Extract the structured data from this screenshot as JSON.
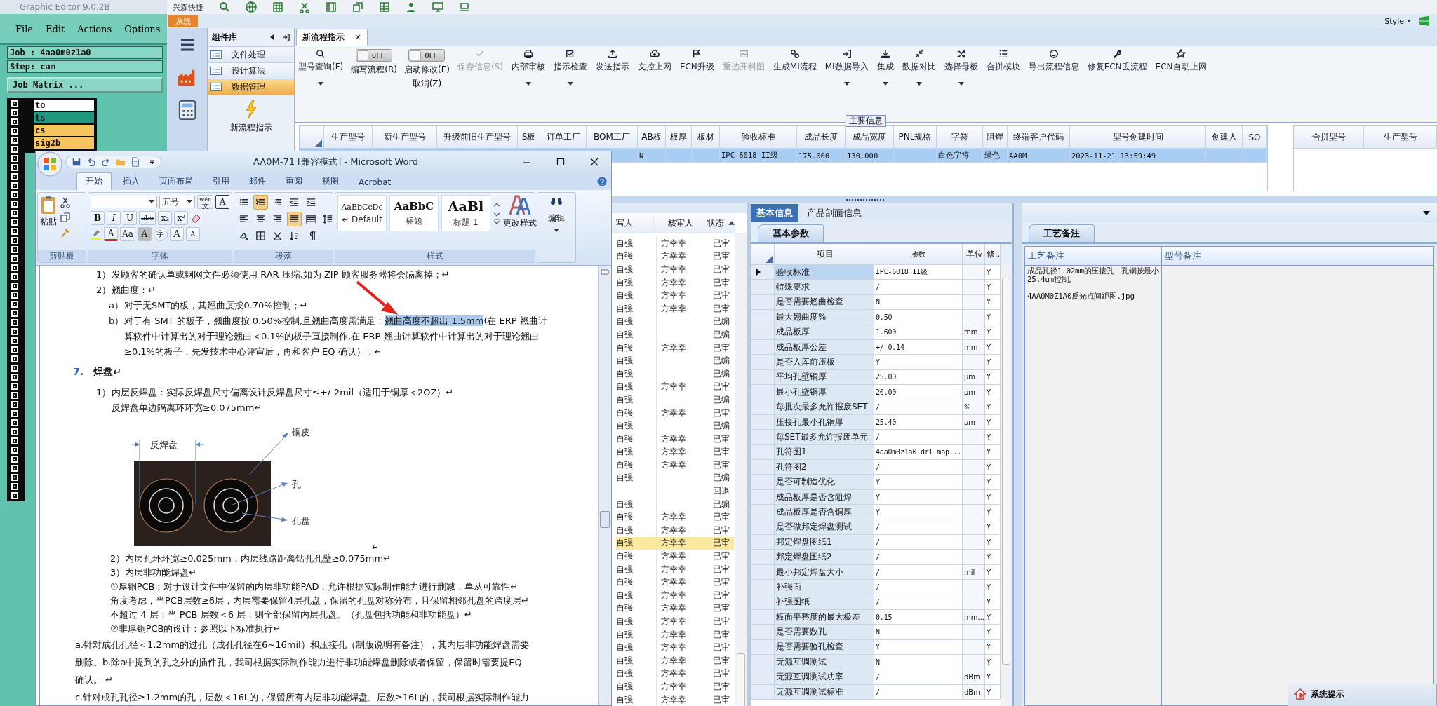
{
  "editor": {
    "title": "Graphic Editor 9.0.2B",
    "menu": [
      "File",
      "Edit",
      "Actions",
      "Options"
    ],
    "job": "Job : 4aa0m0z1a0",
    "step": "Step: cam",
    "matrix_button": "Job Matrix ...",
    "layers": [
      {
        "name": "to",
        "color": "#ffffff"
      },
      {
        "name": "ts",
        "color": "#1f9a80"
      },
      {
        "name": "cs",
        "color": "#f7c45e"
      },
      {
        "name": "sig2b",
        "color": "#f7c45e"
      }
    ]
  },
  "app": {
    "quick_label": "兴森快捷",
    "system_tab": "系统",
    "style_menu": "Style",
    "component_library": {
      "title": "组件库",
      "items": [
        {
          "label": "文件处理",
          "selected": false
        },
        {
          "label": "设计算法",
          "selected": false
        },
        {
          "label": "数据管理",
          "selected": true
        }
      ],
      "launcher": "新流程指示"
    },
    "tab": {
      "label": "新流程指示",
      "close": "×"
    },
    "toolbar": [
      {
        "kind": "button",
        "label": "型号查询(F)",
        "dropdown": true,
        "disabled": false
      },
      {
        "kind": "toggle",
        "text": "OFF",
        "on": false,
        "labels": [
          "编写流程(R)"
        ]
      },
      {
        "kind": "toggle",
        "text": "OFF",
        "on": false,
        "labels": [
          "启动修改(E)",
          "取消(Z)"
        ]
      },
      {
        "kind": "button",
        "label": "保存信息(S)",
        "dropdown": false,
        "disabled": true
      },
      {
        "kind": "button",
        "label": "内部审核",
        "dropdown": true,
        "disabled": false
      },
      {
        "kind": "button",
        "label": "指示检查",
        "dropdown": true,
        "disabled": false
      },
      {
        "kind": "button",
        "label": "发送指示",
        "dropdown": false,
        "disabled": false
      },
      {
        "kind": "button",
        "label": "文控上网",
        "dropdown": false,
        "disabled": false
      },
      {
        "kind": "button",
        "label": "ECN升级",
        "dropdown": false,
        "disabled": false
      },
      {
        "kind": "button",
        "label": "重选开料图",
        "dropdown": false,
        "disabled": true
      },
      {
        "kind": "button",
        "label": "生成MI流程",
        "dropdown": false,
        "disabled": false
      },
      {
        "kind": "button",
        "label": "MI数据导入",
        "dropdown": true,
        "disabled": false
      },
      {
        "kind": "button",
        "label": "集成",
        "dropdown": true,
        "disabled": false
      },
      {
        "kind": "button",
        "label": "数据对比",
        "dropdown": true,
        "disabled": false
      },
      {
        "kind": "button",
        "label": "选择母板",
        "dropdown": true,
        "disabled": false
      },
      {
        "kind": "button",
        "label": "合拼模块",
        "dropdown": false,
        "disabled": false
      },
      {
        "kind": "button",
        "label": "导出流程信息",
        "dropdown": false,
        "disabled": false
      },
      {
        "kind": "button",
        "label": "修复ECN丢流程",
        "dropdown": false,
        "disabled": false
      },
      {
        "kind": "button",
        "label": "ECN自动上网",
        "dropdown": false,
        "disabled": false
      }
    ],
    "main_info": {
      "group_label": "主要信息",
      "columns": [
        "生产型号",
        "新生产型号",
        "升级前旧生产型号",
        "S板",
        "订单工厂",
        "BOM工厂",
        "AB板",
        "板厚",
        "板材",
        "验收标准",
        "成品长度",
        "成品宽度",
        "PNL规格",
        "字符",
        "阻焊",
        "终端客户代码",
        "型号创建时间",
        "创建人",
        "SO"
      ],
      "rows": [
        {
          "selected": true,
          "cells": [
            null,
            null,
            null,
            null,
            null,
            null,
            "N",
            null,
            null,
            "IPC-6018 II级",
            "175.000",
            "130.000",
            null,
            "白色字符",
            "绿色",
            "AA0M",
            "2023-11-21 13:59:49",
            null,
            null
          ]
        }
      ]
    },
    "merge_table": {
      "columns": [
        "合拼型号",
        "生产型号"
      ]
    },
    "review_list": {
      "columns": [
        "写人",
        "核审人",
        "状态"
      ],
      "rows": [
        {
          "writer": "自强",
          "reviewer": "方幸幸",
          "status": "已审",
          "selected": false
        },
        {
          "writer": "自强",
          "reviewer": "方幸幸",
          "status": "已审",
          "selected": false
        },
        {
          "writer": "自强",
          "reviewer": "方幸幸",
          "status": "已审",
          "selected": false
        },
        {
          "writer": "自强",
          "reviewer": "方幸幸",
          "status": "已审",
          "selected": false
        },
        {
          "writer": "自强",
          "reviewer": "方幸幸",
          "status": "已审",
          "selected": false
        },
        {
          "writer": "自强",
          "reviewer": "方幸幸",
          "status": "已审",
          "selected": false
        },
        {
          "writer": "自强",
          "status": "已编",
          "selected": false
        },
        {
          "writer": "自强",
          "status": "已编",
          "selected": false
        },
        {
          "writer": "自强",
          "reviewer": "方幸幸",
          "status": "已审",
          "selected": false
        },
        {
          "writer": "自强",
          "status": "已编",
          "selected": false
        },
        {
          "writer": "自强",
          "status": "已编",
          "selected": false
        },
        {
          "writer": "自强",
          "reviewer": "方幸幸",
          "status": "已审",
          "selected": false
        },
        {
          "writer": "自强",
          "status": "已编",
          "selected": false
        },
        {
          "writer": "自强",
          "reviewer": "方幸幸",
          "status": "已审",
          "selected": false
        },
        {
          "writer": "自强",
          "status": "已编",
          "selected": false
        },
        {
          "writer": "自强",
          "reviewer": "方幸幸",
          "status": "已审",
          "selected": false
        },
        {
          "writer": "自强",
          "reviewer": "方幸幸",
          "status": "已审",
          "selected": false
        },
        {
          "writer": "自强",
          "reviewer": "方幸幸",
          "status": "已审",
          "selected": false
        },
        {
          "writer": "自强",
          "status": "已编",
          "selected": false
        },
        {
          "status": "回退",
          "selected": false
        },
        {
          "writer": "自强",
          "status": "已编",
          "selected": false
        },
        {
          "writer": "自强",
          "reviewer": "方幸幸",
          "status": "已审",
          "selected": false
        },
        {
          "writer": "自强",
          "reviewer": "方幸幸",
          "status": "已审",
          "selected": false
        },
        {
          "writer": "自强",
          "reviewer": "方幸幸",
          "status": "已审",
          "selected": true
        },
        {
          "writer": "自强",
          "reviewer": "方幸幸",
          "status": "已审",
          "selected": false
        },
        {
          "writer": "自强",
          "reviewer": "方幸幸",
          "status": "已审",
          "selected": false
        },
        {
          "writer": "自强",
          "reviewer": "方幸幸",
          "status": "已审",
          "selected": false
        },
        {
          "writer": "自强",
          "reviewer": "方幸幸",
          "status": "已审",
          "selected": false
        },
        {
          "writer": "自强",
          "reviewer": "方幸幸",
          "status": "已审",
          "selected": false
        },
        {
          "writer": "自强",
          "reviewer": "方幸幸",
          "status": "已审",
          "selected": false
        },
        {
          "writer": "自强",
          "reviewer": "方幸幸",
          "status": "已审",
          "selected": false
        },
        {
          "writer": "自强",
          "reviewer": "方幸幸",
          "status": "已审",
          "selected": false
        },
        {
          "writer": "自强",
          "reviewer": "方幸幸",
          "status": "已审",
          "selected": false
        },
        {
          "writer": "自强",
          "reviewer": "方幸幸",
          "status": "已审",
          "selected": false
        },
        {
          "writer": "自强",
          "reviewer": "方幸幸",
          "status": "已审",
          "selected": false
        },
        {
          "writer": "自强",
          "reviewer": "方幸幸",
          "status": "已审",
          "selected": false
        }
      ]
    },
    "basic_info": {
      "tabs": [
        {
          "label": "基本信息",
          "selected": true
        },
        {
          "label": "产品剖面信息",
          "selected": false
        }
      ],
      "subtab": "基本参数",
      "columns": [
        "项目",
        "参数",
        "单位",
        "修.."
      ],
      "rows": [
        {
          "item": "验收标准",
          "value": "IPC-6018 II级",
          "flag": "Y",
          "selected": true
        },
        {
          "item": "特殊要求",
          "value": "/",
          "flag": "Y",
          "selected": false
        },
        {
          "item": "是否需要翘曲检查",
          "value": "N",
          "flag": "Y",
          "selected": false
        },
        {
          "item": "最大翘曲度%",
          "value": "0.50",
          "flag": "Y",
          "selected": false
        },
        {
          "item": "成品板厚",
          "value": "1.600",
          "unit": "mm",
          "flag": "Y",
          "selected": false
        },
        {
          "item": "成品板厚公差",
          "value": "+/-0.14",
          "unit": "mm",
          "flag": "Y",
          "selected": false
        },
        {
          "item": "是否入库前压板",
          "value": "Y",
          "flag": "Y",
          "selected": false
        },
        {
          "item": "平均孔壁铜厚",
          "value": "25.00",
          "unit": "µm",
          "flag": "Y",
          "selected": false
        },
        {
          "item": "最小孔壁铜厚",
          "value": "20.00",
          "unit": "µm",
          "flag": "Y",
          "selected": false
        },
        {
          "item": "每批次最多允许报废SET",
          "value": "/",
          "unit": "%",
          "flag": "Y",
          "selected": false
        },
        {
          "item": "压接孔最小孔铜厚",
          "value": "25.40",
          "unit": "µm",
          "flag": "Y",
          "selected": false
        },
        {
          "item": "每SET最多允许报废单元",
          "value": "/",
          "flag": "Y",
          "selected": false
        },
        {
          "item": "孔符图1",
          "value": "4aa0m0z1a0_drl_map...",
          "flag": "Y",
          "selected": false
        },
        {
          "item": "孔符图2",
          "value": "/",
          "flag": "Y",
          "selected": false
        },
        {
          "item": "是否可制造优化",
          "value": "Y",
          "flag": "Y",
          "selected": false
        },
        {
          "item": "成品板厚是否含阻焊",
          "value": "Y",
          "flag": "Y",
          "selected": false
        },
        {
          "item": "成品板厚是否含铜厚",
          "value": "Y",
          "flag": "Y",
          "selected": false
        },
        {
          "item": "是否做邦定焊盘测试",
          "value": "/",
          "flag": "Y",
          "selected": false
        },
        {
          "item": "邦定焊盘图纸1",
          "value": "/",
          "flag": "Y",
          "selected": false
        },
        {
          "item": "邦定焊盘图纸2",
          "value": "/",
          "flag": "Y",
          "selected": false
        },
        {
          "item": "最小邦定焊盘大小",
          "value": "/",
          "unit": "mil",
          "flag": "Y",
          "selected": false
        },
        {
          "item": "补强面",
          "value": "/",
          "flag": "Y",
          "selected": false
        },
        {
          "item": "补强图纸",
          "value": "/",
          "flag": "Y",
          "selected": false
        },
        {
          "item": "板面平整度的最大极差",
          "value": "0.15",
          "unit": "mm...",
          "flag": "Y",
          "selected": false
        },
        {
          "item": "是否需要数孔",
          "value": "N",
          "flag": "Y",
          "selected": false
        },
        {
          "item": "是否需要验孔检查",
          "value": "Y",
          "flag": "Y",
          "selected": false
        },
        {
          "item": "无源互调测试",
          "value": "N",
          "flag": "Y",
          "selected": false
        },
        {
          "item": "无源互调测试功率",
          "value": "/",
          "unit": "dBm",
          "flag": "Y",
          "selected": false
        },
        {
          "item": "无源互调测试标准",
          "value": "/",
          "unit": "dBm",
          "flag": "Y",
          "selected": false
        }
      ]
    },
    "notes": {
      "tab": "工艺备注",
      "columns": [
        "工艺备注",
        "型号备注"
      ],
      "process_notes": [
        "成品孔径1.02mm的压接孔，孔铜按最小25.4um控制。",
        "4AA0M0Z1A0反光点间距图.jpg"
      ]
    },
    "popup": {
      "title": "系统提示"
    }
  },
  "word": {
    "title": "AA0M-71 [兼容模式] - Microsoft Word",
    "tabs": [
      {
        "label": "开始",
        "selected": true
      },
      {
        "label": "插入",
        "selected": false
      },
      {
        "label": "页面布局",
        "selected": false
      },
      {
        "label": "引用",
        "selected": false
      },
      {
        "label": "邮件",
        "selected": false
      },
      {
        "label": "审阅",
        "selected": false
      },
      {
        "label": "视图",
        "selected": false
      },
      {
        "label": "Acrobat",
        "selected": false
      }
    ],
    "clipboard": {
      "paste": "粘贴",
      "label": "剪贴板"
    },
    "font": {
      "label": "字体",
      "size": "五号",
      "pinyin_top": "wén",
      "pinyin_bottom": "文",
      "boxed": "A",
      "row2": [
        {
          "text": "B",
          "kind": "bold"
        },
        {
          "text": "I",
          "kind": "italic"
        },
        {
          "text": "U",
          "kind": "underline"
        },
        {
          "text": "abe",
          "kind": "strike"
        },
        {
          "text": "x₂",
          "kind": "plain"
        },
        {
          "text": "x²",
          "kind": "plain"
        }
      ],
      "row3": [
        {
          "text": "A",
          "kind": "color"
        },
        {
          "text": "Aa",
          "kind": "plain"
        },
        {
          "text": "A",
          "kind": "shade"
        },
        {
          "text": "字",
          "kind": "circle"
        },
        {
          "text": "A",
          "kind": "grow"
        },
        {
          "text": "A",
          "kind": "shrink"
        }
      ]
    },
    "paragraph": {
      "label": "段落",
      "buttons": [
        {
          "selected": false
        },
        {
          "selected": true
        },
        {
          "selected": false
        },
        {
          "selected": false
        },
        {
          "selected": false
        },
        {
          "selected": false
        },
        {
          "selected": false
        },
        {
          "selected": false
        },
        {
          "selected": true
        },
        {
          "selected": false
        },
        {
          "selected": false
        },
        {
          "selected": false
        },
        {
          "selected": false
        },
        {
          "selected": false
        },
        {
          "selected": false
        },
        {
          "selected": false
        }
      ]
    },
    "styles": {
      "label": "样式",
      "items": [
        {
          "preview": "AaBbCcDc",
          "name": "↵ Default"
        },
        {
          "preview": "AaBbC",
          "name": "标题"
        },
        {
          "preview": "AaBl",
          "name": "标题 1"
        }
      ],
      "change": "更改样式"
    },
    "edit": "编辑",
    "document": [
      {
        "kind": "item",
        "marker": "1）",
        "lines": [
          "发顾客的确认单或钢网文件必须使用 RAR 压缩,如为 ZIP 顾客服务器将会隔离掉；↵"
        ]
      },
      {
        "kind": "item",
        "marker": "2）",
        "lines": [
          "翘曲度：↵"
        ]
      },
      {
        "kind": "subitem",
        "marker": "a）",
        "lines": [
          "对于无SMT的板，其翘曲度按0.70%控制；↵"
        ]
      },
      {
        "kind": "subitem",
        "marker": "b）",
        "lines": [
          {
            "parts": [
              {
                "text": "对于有 SMT 的板子，翘曲度按 0.50%控制,且翘曲高度需满足：",
                "selected": false
              },
              {
                "text": "翘曲高度不超出 1.5mm",
                "selected": true
              },
              {
                "text": "(在 ERP 翘曲计",
                "selected": false
              }
            ]
          },
          "算软件中计算出的对于理论翘曲＜0.1%的板子直接制作,在 ERP 翘曲计算软件中计算出的对于理论翘曲",
          "≥0.1%的板子，先发技术中心评审后，再和客户 EQ 确认）；↵"
        ]
      },
      {
        "kind": "heading",
        "marker": "7.",
        "lines": [
          "焊盘↵"
        ]
      },
      {
        "kind": "item",
        "marker": "1）",
        "lines": [
          "内层反焊盘：实际反焊盘尺寸偏离设计反焊盘尺寸≤+/-2mil（适用于铜厚＜2OZ）↵",
          "反焊盘单边隔离环环宽≥0.075mm↵"
        ]
      },
      {
        "kind": "figure",
        "labels": [
          "反焊盘",
          "铜皮",
          "孔",
          "孔盘"
        ],
        "mark": "↵"
      },
      {
        "kind": "indented",
        "lines": [
          "2）内层孔环环宽≥0.025mm，内层线路距离钻孔孔壁≥0.075mm↵"
        ]
      },
      {
        "kind": "indented",
        "lines": [
          "3）内层非功能焊盘↵"
        ]
      },
      {
        "kind": "indented",
        "lines": [
          "①厚铜PCB：对于设计文件中保留的内层非功能PAD，允许根据实际制作能力进行删减，单从可靠性↵"
        ]
      },
      {
        "kind": "indented",
        "lines": [
          "角度考虑，当PCB层数≥6层，内层需要保留4层孔盘，保留的孔盘对称分布，且保留相邻孔盘的跨度层↵"
        ]
      },
      {
        "kind": "indented",
        "lines": [
          "不超过 4 层；当 PCB 层数＜6 层，则全部保留内层孔盘。（孔盘包括功能和非功能盘）↵"
        ]
      },
      {
        "kind": "indented",
        "lines": [
          "②非厚铜PCB的设计：参照以下标准执行↵"
        ]
      },
      {
        "kind": "body",
        "lines": [
          "a.针对成孔孔径＜1.2mm的过孔（成孔孔径在6~16mil）和压接孔（制版说明有备注），其内层非功能焊盘需要",
          "删除。b.除a中提到的孔之外的插件孔，我司根据实际制作能力进行非功能焊盘删除或者保留，保留时需要提EQ",
          "确认。 ↵"
        ]
      },
      {
        "kind": "body",
        "lines": [
          "c.针对成孔孔径≥1.2mm的孔，层数＜16L的，保留所有内层非功能焊盘。层数≥16L的，我司根据实际制作能力"
        ]
      }
    ]
  }
}
